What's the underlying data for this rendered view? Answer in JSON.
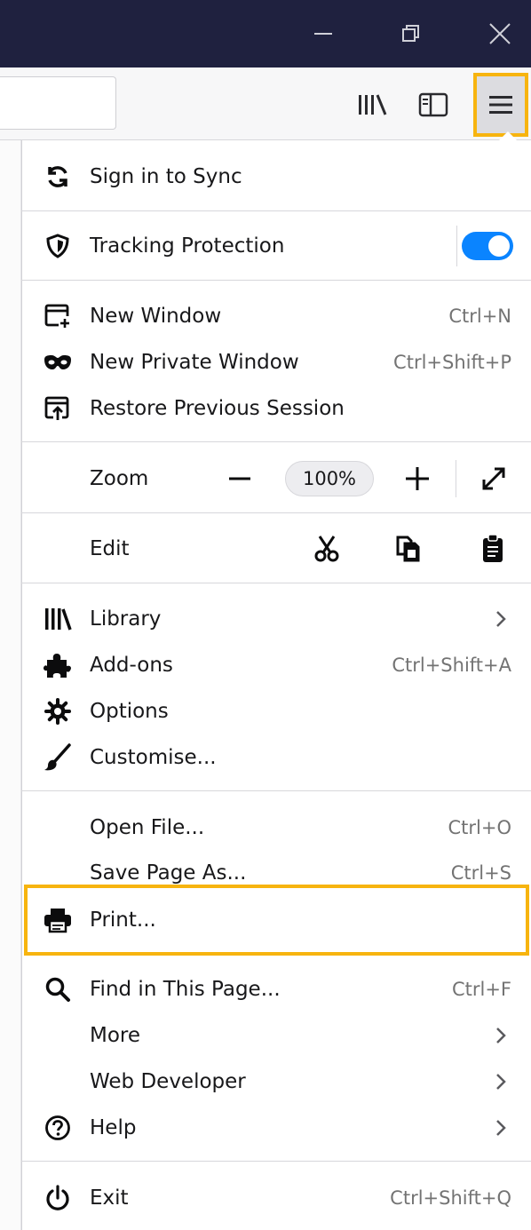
{
  "window_controls": {
    "minimize_icon": "minimize-icon",
    "restore_icon": "restore-icon",
    "close_icon": "close-icon"
  },
  "toolbar": {
    "library_icon": "library-icon",
    "sidebar_icon": "sidebar-icon",
    "menu_icon": "hamburger-menu-icon"
  },
  "menu": {
    "sync": {
      "label": "Sign in to Sync"
    },
    "tracking": {
      "label": "Tracking Protection",
      "enabled": true
    },
    "new_window": {
      "label": "New Window",
      "shortcut": "Ctrl+N"
    },
    "new_private": {
      "label": "New Private Window",
      "shortcut": "Ctrl+Shift+P"
    },
    "restore_session": {
      "label": "Restore Previous Session"
    },
    "zoom": {
      "label": "Zoom",
      "level": "100%"
    },
    "edit": {
      "label": "Edit"
    },
    "library": {
      "label": "Library"
    },
    "addons": {
      "label": "Add-ons",
      "shortcut": "Ctrl+Shift+A"
    },
    "options": {
      "label": "Options"
    },
    "customise": {
      "label": "Customise..."
    },
    "open_file": {
      "label": "Open File...",
      "shortcut": "Ctrl+O"
    },
    "save_page": {
      "label": "Save Page As...",
      "shortcut": "Ctrl+S"
    },
    "print": {
      "label": "Print..."
    },
    "find": {
      "label": "Find in This Page...",
      "shortcut": "Ctrl+F"
    },
    "more": {
      "label": "More"
    },
    "web_developer": {
      "label": "Web Developer"
    },
    "help": {
      "label": "Help"
    },
    "exit": {
      "label": "Exit",
      "shortcut": "Ctrl+Shift+Q"
    }
  },
  "colors": {
    "titlebar": "#1f213f",
    "highlight": "#f7b40f",
    "toggle_on": "#0a84ff"
  }
}
